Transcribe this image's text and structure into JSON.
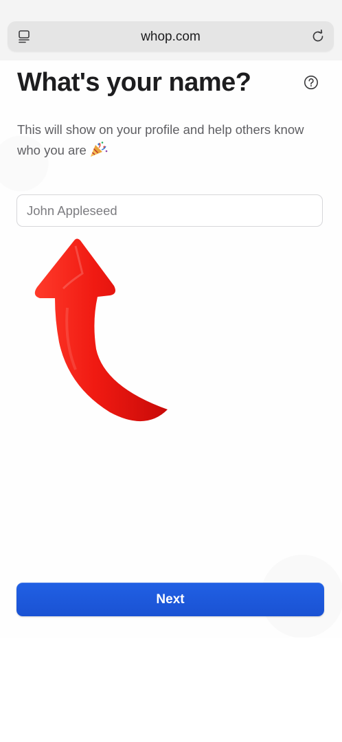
{
  "browser": {
    "url": "whop.com",
    "tabs_icon": "tab-overview-icon",
    "reload_icon": "reload-icon"
  },
  "onboarding": {
    "title": "What's your name?",
    "help_icon": "question-circle-icon",
    "subtitle": "This will show on your profile and help others know who you are",
    "subtitle_emoji": "🎉",
    "name_input": {
      "placeholder": "John Appleseed",
      "value": ""
    },
    "annotation_arrow_color": "#e81010",
    "next_label": "Next",
    "next_color": "#1a56db"
  }
}
